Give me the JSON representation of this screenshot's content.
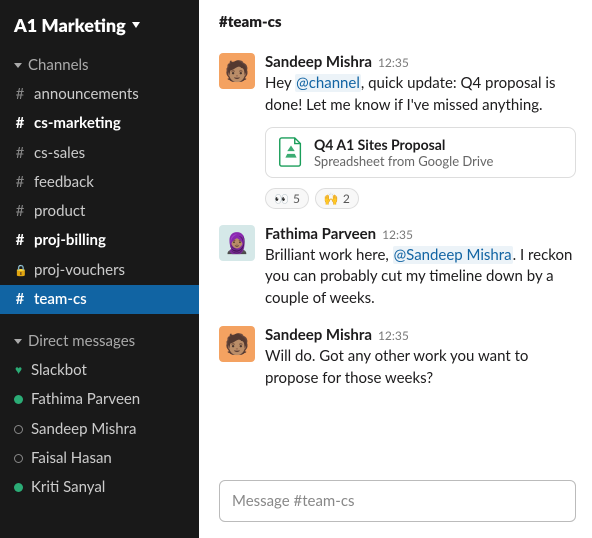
{
  "workspace": {
    "name": "A1 Marketing"
  },
  "sidebar": {
    "channels_label": "Channels",
    "dm_label": "Direct messages",
    "channels": [
      {
        "name": "announcements",
        "bold": false,
        "private": false,
        "active": false
      },
      {
        "name": "cs-marketing",
        "bold": true,
        "private": false,
        "active": false
      },
      {
        "name": "cs-sales",
        "bold": false,
        "private": false,
        "active": false
      },
      {
        "name": "feedback",
        "bold": false,
        "private": false,
        "active": false
      },
      {
        "name": "product",
        "bold": false,
        "private": false,
        "active": false
      },
      {
        "name": "proj-billing",
        "bold": true,
        "private": false,
        "active": false
      },
      {
        "name": "proj-vouchers",
        "bold": false,
        "private": true,
        "active": false
      },
      {
        "name": "team-cs",
        "bold": false,
        "private": false,
        "active": true
      }
    ],
    "dms": [
      {
        "name": "Slackbot",
        "status": "heart"
      },
      {
        "name": "Fathima Parveen",
        "status": "online"
      },
      {
        "name": "Sandeep Mishra",
        "status": "away"
      },
      {
        "name": "Faisal Hasan",
        "status": "away"
      },
      {
        "name": "Kriti Sanyal",
        "status": "online"
      }
    ]
  },
  "header": {
    "channel_title": "#team-cs"
  },
  "messages": [
    {
      "user": "Sandeep Mishra",
      "time": "12:35",
      "avatar": "orange",
      "segments": [
        {
          "t": "text",
          "v": "Hey "
        },
        {
          "t": "mention",
          "v": "@channel"
        },
        {
          "t": "text",
          "v": ", quick update: Q4 proposal is done! Let me know if I've missed anything."
        }
      ],
      "attachment": {
        "title": "Q4 A1 Sites Proposal",
        "subtitle": "Spreadsheet from Google Drive"
      },
      "reactions": [
        {
          "emoji": "👀",
          "count": 5
        },
        {
          "emoji": "🙌",
          "count": 2
        }
      ]
    },
    {
      "user": "Fathima Parveen",
      "time": "12:35",
      "avatar": "teal",
      "segments": [
        {
          "t": "text",
          "v": "Brilliant work here, "
        },
        {
          "t": "mention",
          "v": "@Sandeep Mishra"
        },
        {
          "t": "text",
          "v": ". I reckon you can probably cut my timeline down by a couple of weeks."
        }
      ]
    },
    {
      "user": "Sandeep Mishra",
      "time": "12:35",
      "avatar": "orange",
      "segments": [
        {
          "t": "text",
          "v": "Will do. Got any other work you want to propose for those weeks?"
        }
      ]
    }
  ],
  "composer": {
    "placeholder": "Message #team-cs"
  }
}
